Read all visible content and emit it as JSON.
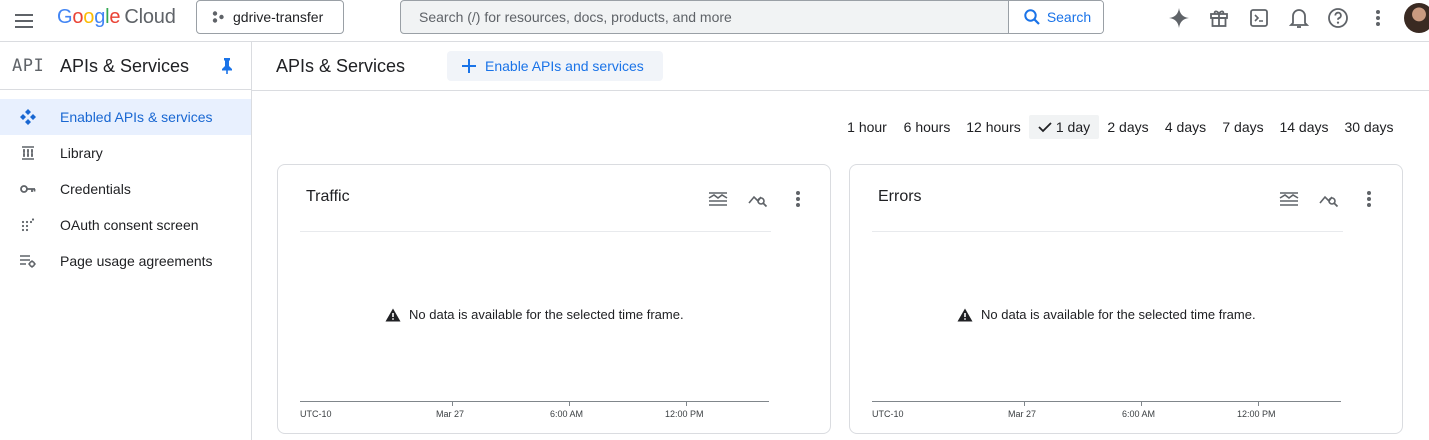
{
  "header": {
    "logo_google": [
      "G",
      "o",
      "o",
      "g",
      "l",
      "e"
    ],
    "logo_cloud": "Cloud",
    "project": "gdrive-transfer",
    "search_placeholder": "Search (/) for resources, docs, products, and more",
    "search_button": "Search",
    "icons": [
      "gemini-icon",
      "gift-icon",
      "cloud-shell-icon",
      "notifications-icon",
      "help-icon",
      "more-vert-icon"
    ]
  },
  "sidebar": {
    "badge": "API",
    "title": "APIs & Services",
    "items": [
      {
        "label": "Enabled APIs & services",
        "icon": "enabled-apis-icon",
        "active": true
      },
      {
        "label": "Library",
        "icon": "library-icon",
        "active": false
      },
      {
        "label": "Credentials",
        "icon": "key-icon",
        "active": false
      },
      {
        "label": "OAuth consent screen",
        "icon": "oauth-icon",
        "active": false
      },
      {
        "label": "Page usage agreements",
        "icon": "settings-list-icon",
        "active": false
      }
    ]
  },
  "main": {
    "title": "APIs & Services",
    "enable_button": "Enable APIs and services",
    "time_ranges": [
      "1 hour",
      "6 hours",
      "12 hours",
      "1 day",
      "2 days",
      "4 days",
      "7 days",
      "14 days",
      "30 days"
    ],
    "selected_range": "1 day",
    "cards": [
      {
        "title": "Traffic",
        "message": "No data is available for the selected time frame.",
        "x_labels": [
          "UTC-10",
          "Mar 27",
          "6:00 AM",
          "12:00 PM"
        ]
      },
      {
        "title": "Errors",
        "message": "No data is available for the selected time frame.",
        "x_labels": [
          "UTC-10",
          "Mar 27",
          "6:00 AM",
          "12:00 PM"
        ]
      }
    ]
  },
  "colors": {
    "accent": "#1a73e8",
    "active_bg": "#e8f0fe",
    "border": "#dadce0"
  }
}
